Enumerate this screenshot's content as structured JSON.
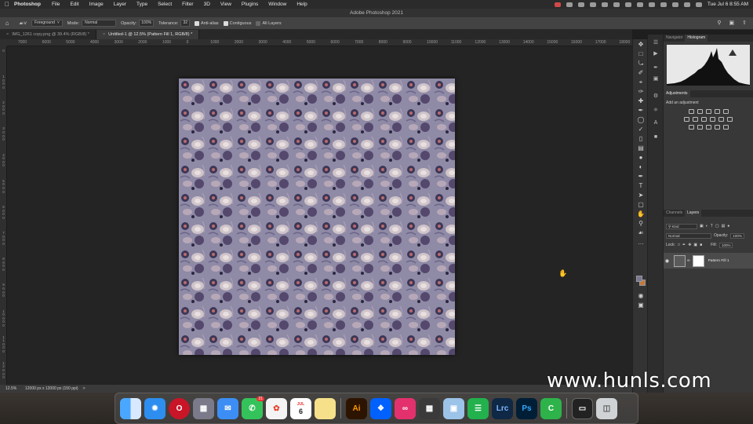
{
  "menubar": {
    "app": "Photoshop",
    "items": [
      "File",
      "Edit",
      "Image",
      "Layer",
      "Type",
      "Select",
      "Filter",
      "3D",
      "View",
      "Plugins",
      "Window",
      "Help"
    ],
    "clock": "Tue Jul 6  8:55 AM"
  },
  "window": {
    "title": "Adobe Photoshop 2021"
  },
  "options": {
    "fill_source": "Foreground",
    "mode_label": "Mode:",
    "mode_value": "Normal",
    "opacity_label": "Opacity:",
    "opacity_value": "100%",
    "tolerance_label": "Tolerance:",
    "tolerance_value": "32",
    "antialias_label": "Anti-alias",
    "contiguous_label": "Contiguous",
    "all_layers_label": "All Layers"
  },
  "tabs": [
    {
      "label": "IMG_1261 copy.png @ 39.4% (RGB/8) *",
      "active": false
    },
    {
      "label": "Untitled-1 @ 12.5% (Pattern Fill 1, RGB/8) *",
      "active": true
    }
  ],
  "ruler": {
    "h_labels": [
      "7000",
      "6000",
      "5000",
      "4000",
      "3000",
      "2000",
      "1000",
      "0",
      "1000",
      "2000",
      "3000",
      "4000",
      "5000",
      "6000",
      "7000",
      "8000",
      "9000",
      "10000",
      "11000",
      "12000",
      "13000",
      "14000",
      "15000",
      "16000",
      "17000",
      "18000"
    ],
    "v_labels": [
      "0",
      "1000",
      "2000",
      "3000",
      "4000",
      "5000",
      "6000",
      "7000",
      "8000",
      "9000",
      "10000",
      "11000",
      "12000"
    ]
  },
  "status": {
    "zoom": "12.5%",
    "dims": "12000 px x 12000 px (150 ppi)",
    "more": ">"
  },
  "panels": {
    "top_tabs": [
      "Navigator",
      "Histogram"
    ],
    "top_active": "Histogram",
    "adjustments_tab": "Adjustments",
    "adjustments_hint": "Add an adjustment",
    "layer_tabs": [
      "Channels",
      "Layers"
    ],
    "layer_active": "Layers",
    "kind": "Kind",
    "blend": "Normal",
    "opacity_label": "Opacity:",
    "opacity": "100%",
    "lock_label": "Lock:",
    "fill_label": "Fill:",
    "fill": "100%",
    "layer_name": "Pattern Fill 1"
  },
  "dock": {
    "messages_badge": "21",
    "calendar_month": "JUL",
    "calendar_day": "6",
    "apps": [
      "Finder",
      "Safari",
      "Opera",
      "Launchpad",
      "Mail",
      "Messages",
      "Photos",
      "Calendar",
      "Notes",
      "Illustrator",
      "Dropbox",
      "Creative Cloud",
      "Calculator",
      "Preview",
      "Numbers",
      "Lightroom Classic",
      "Photoshop",
      "Coda",
      "Screen",
      "Trash"
    ]
  },
  "watermark": "www.hunls.com",
  "colors": {
    "foreground": "#7b7895",
    "background": "#c3783c",
    "pattern_base": "#8a86a0"
  }
}
